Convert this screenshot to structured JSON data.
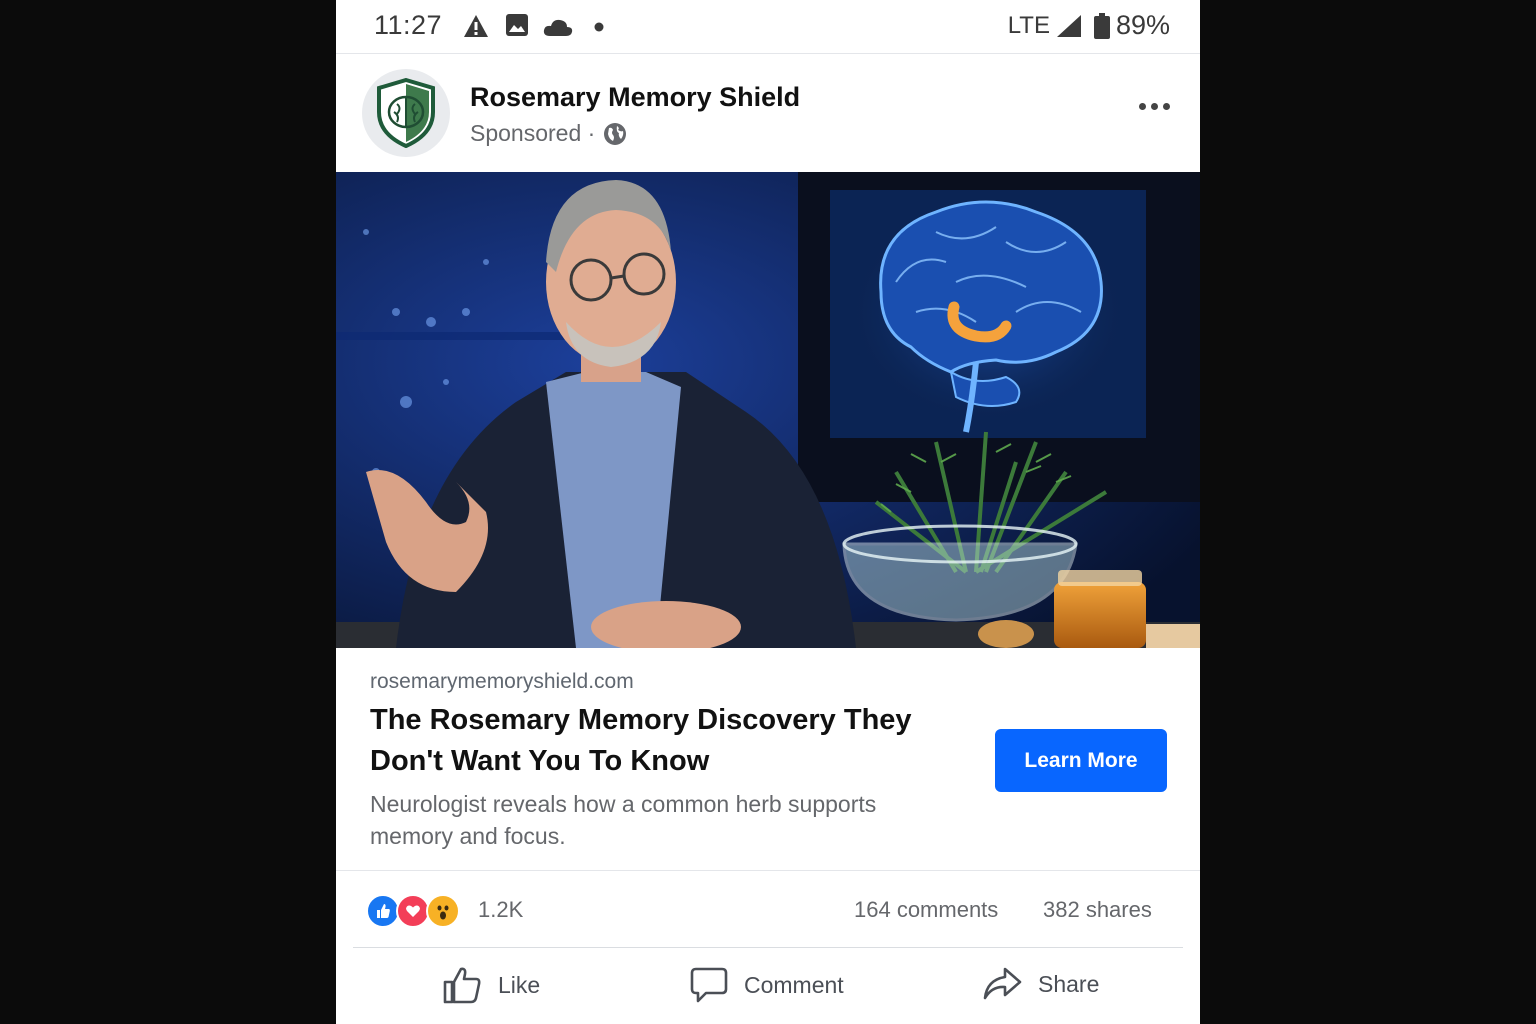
{
  "status_bar": {
    "time": "11:27",
    "network": "LTE",
    "battery": "89%",
    "icons": [
      "warning-icon",
      "image-icon",
      "cloud-icon",
      "dot-icon",
      "signal-icon",
      "battery-icon"
    ]
  },
  "post": {
    "page_name": "Rosemary Memory Shield",
    "sponsored_label": "Sponsored",
    "sponsored_separator": " ·",
    "audience_icon": "globe-icon",
    "more_icon": "more-options-icon"
  },
  "link_preview": {
    "domain": "rosemarymemoryshield.com",
    "headline": "The Rosemary Memory Discovery They Don't Want You To Know",
    "description": "Neurologist reveals how a common herb supports memory and focus.",
    "cta_label": "Learn More",
    "cta_color": "#0866ff"
  },
  "engagement": {
    "reactions": [
      "like",
      "love",
      "wow"
    ],
    "reaction_count": "1.2K",
    "comments": "164 comments",
    "shares": "382 shares"
  },
  "actions": {
    "like": "Like",
    "comment": "Comment",
    "share": "Share"
  }
}
